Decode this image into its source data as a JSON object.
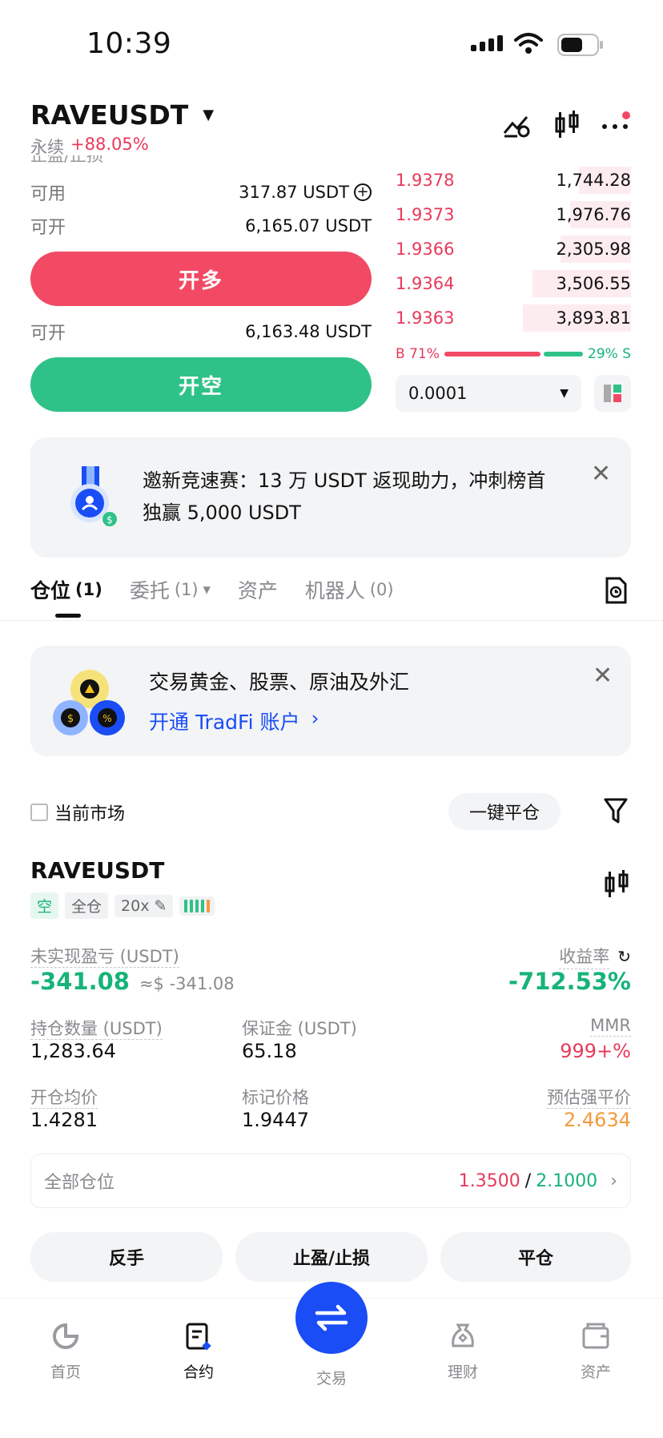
{
  "status_bar": {
    "time": "10:39"
  },
  "header": {
    "pair": "RAVEUSDT",
    "perp_label": "永续",
    "change": "+88.05%"
  },
  "trade_form": {
    "partial_tp_sl": "止盈/止损",
    "available_label": "可用",
    "available_value": "317.87 USDT",
    "open_label": "可开",
    "open_long_value": "6,165.07 USDT",
    "long_button": "开多",
    "open_short_value": "6,163.48 USDT",
    "short_button": "开空"
  },
  "orderbook": {
    "asks": [
      {
        "price": "1.9378",
        "qty": "1,744.28",
        "depth": 0.22
      },
      {
        "price": "1.9373",
        "qty": "1,976.76",
        "depth": 0.26
      },
      {
        "price": "1.9366",
        "qty": "2,305.98",
        "depth": 0.3
      },
      {
        "price": "1.9364",
        "qty": "3,506.55",
        "depth": 0.42
      },
      {
        "price": "1.9363",
        "qty": "3,893.81",
        "depth": 0.46
      }
    ],
    "buy_pct_label": "B 71%",
    "sell_pct_label": "29% S",
    "buy_ratio": 0.71,
    "precision": "0.0001"
  },
  "promo_banner": {
    "text": "邀新竞速赛：13 万 USDT 返现助力，冲刺榜首独赢 5,000 USDT"
  },
  "tabs": [
    {
      "label": "仓位",
      "count": "(1)"
    },
    {
      "label": "委托",
      "count": "(1)"
    },
    {
      "label": "资产",
      "count": ""
    },
    {
      "label": "机器人",
      "count": "(0)"
    }
  ],
  "tradfi_banner": {
    "title": "交易黄金、股票、原油及外汇",
    "link": "开通 TradFi 账户"
  },
  "filters": {
    "current_market": "当前市场",
    "close_all": "一键平仓"
  },
  "position": {
    "symbol": "RAVEUSDT",
    "side": "空",
    "margin_mode": "全仓",
    "leverage": "20x",
    "unrealized_label": "未实现盈亏 (USDT)",
    "unrealized_value": "-341.08",
    "unrealized_usd": "≈$ -341.08",
    "roe_label": "收益率",
    "roe_value": "-712.53%",
    "size_label": "持仓数量 (USDT)",
    "size_value": "1,283.64",
    "margin_label": "保证金 (USDT)",
    "margin_value": "65.18",
    "mmr_label": "MMR",
    "mmr_value": "999+%",
    "entry_label": "开仓均价",
    "entry_value": "1.4281",
    "mark_label": "标记价格",
    "mark_value": "1.9447",
    "liq_label": "预估强平价",
    "liq_value": "2.4634",
    "all_positions_label": "全部仓位",
    "tp_value": "1.3500",
    "sl_value": "2.1000"
  },
  "actions": {
    "reverse": "反手",
    "tp_sl": "止盈/止损",
    "close": "平仓"
  },
  "nav": [
    {
      "label": "首页"
    },
    {
      "label": "合约"
    },
    {
      "label": "交易"
    },
    {
      "label": "理财"
    },
    {
      "label": "资产"
    }
  ],
  "colors": {
    "red": "#e8395a",
    "green": "#17b378",
    "blue": "#1a4df5"
  }
}
